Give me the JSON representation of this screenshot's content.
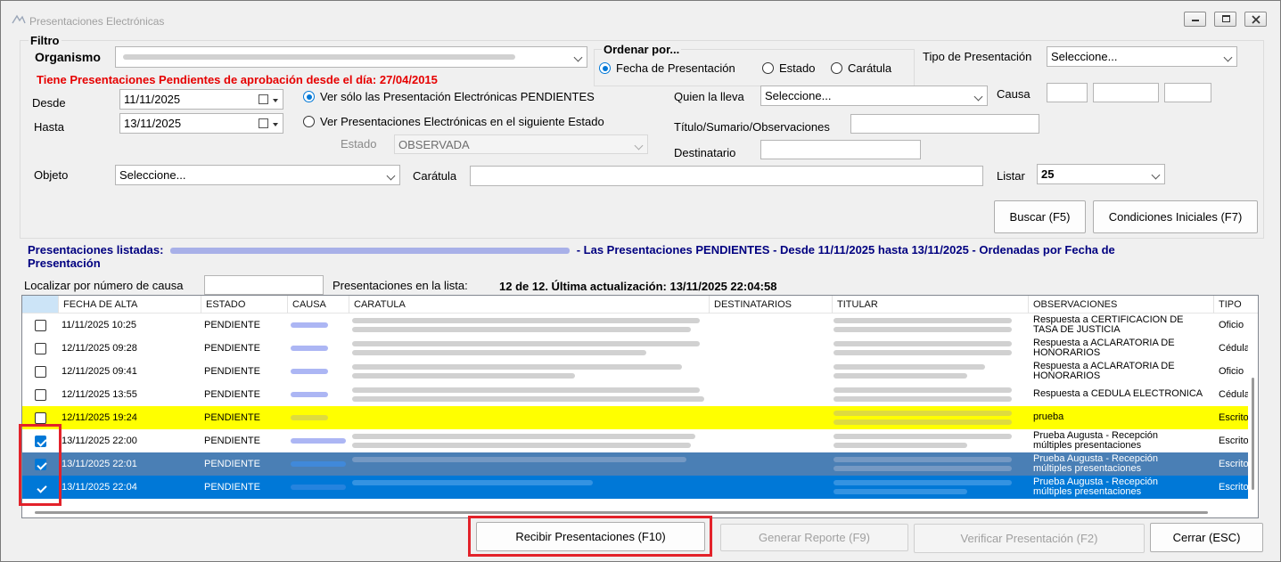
{
  "window": {
    "title": "Presentaciones Electrónicas"
  },
  "filtro": {
    "legend": "Filtro",
    "organismo_label": "Organismo",
    "alert": "Tiene Presentaciones Pendientes de aprobación desde el día: 27/04/2015",
    "desde_label": "Desde",
    "desde_value": "11/11/2025",
    "hasta_label": "Hasta",
    "hasta_value": "13/11/2025",
    "radio_pendientes": "Ver sólo las Presentación Electrónicas PENDIENTES",
    "radio_estado": "Ver Presentaciones Electrónicas en el siguiente Estado",
    "estado_label": "Estado",
    "estado_value": "OBSERVADA",
    "ordenar_label": "Ordenar por...",
    "ordenar_fecha": "Fecha de Presentación",
    "ordenar_estado": "Estado",
    "ordenar_caratula": "Carátula",
    "tipo_label": "Tipo de Presentación",
    "tipo_value": "Seleccione...",
    "quien_label": "Quien la lleva",
    "quien_value": "Seleccione...",
    "causa_label": "Causa",
    "titulo_label": "Título/Sumario/Observaciones",
    "destinatario_label": "Destinatario",
    "objeto_label": "Objeto",
    "objeto_value": "Seleccione...",
    "caratula_label": "Carátula",
    "listar_label": "Listar",
    "listar_value": "25",
    "buscar_button": "Buscar (F5)",
    "condiciones_button": "Condiciones Iniciales (F7)"
  },
  "summary": {
    "prefix": "Presentaciones listadas:",
    "suffix": "- Las Presentaciones PENDIENTES - Desde 11/11/2025 hasta 13/11/2025 - Ordenadas por Fecha de",
    "line2": "Presentación"
  },
  "localizar_label": "Localizar por número de causa",
  "lista_label": "Presentaciones en la lista:",
  "lista_value": "12 de 12. Última actualización: 13/11/2025 22:04:58",
  "grid": {
    "headers": [
      "FECHA DE ALTA",
      "ESTADO",
      "CAUSA",
      "CARATULA",
      "DESTINATARIOS",
      "TITULAR",
      "OBSERVACIONES",
      "TIPO"
    ],
    "rows": [
      {
        "fecha": "11/11/2025 10:25",
        "estado": "PENDIENTE",
        "obs1": "Respuesta a CERTIFICACION DE",
        "obs2": "TASA DE JUSTICIA",
        "tipo": "Oficio",
        "checked": false,
        "style": "normal"
      },
      {
        "fecha": "12/11/2025 09:28",
        "estado": "PENDIENTE",
        "obs1": "Respuesta a ACLARATORIA DE",
        "obs2": "HONORARIOS",
        "tipo": "Cédula",
        "checked": false,
        "style": "normal"
      },
      {
        "fecha": "12/11/2025 09:41",
        "estado": "PENDIENTE",
        "obs1": "Respuesta a ACLARATORIA DE",
        "obs2": "HONORARIOS",
        "tipo": "Oficio",
        "checked": false,
        "style": "normal"
      },
      {
        "fecha": "12/11/2025 13:55",
        "estado": "PENDIENTE",
        "obs1": "Respuesta a CEDULA ELECTRONICA",
        "obs2": "",
        "tipo": "Cédula",
        "checked": false,
        "style": "normal"
      },
      {
        "fecha": "12/11/2025 19:24",
        "estado": "PENDIENTE",
        "obs1": "prueba",
        "obs2": "",
        "tipo": "Escrito",
        "checked": false,
        "style": "yellow"
      },
      {
        "fecha": "13/11/2025 22:00",
        "estado": "PENDIENTE",
        "obs1": "Prueba Augusta -  Recepción",
        "obs2": "múltiples presentaciones",
        "tipo": "Escrito",
        "checked": true,
        "style": "normal"
      },
      {
        "fecha": "13/11/2025 22:01",
        "estado": "PENDIENTE",
        "obs1": "Prueba Augusta -  Recepción",
        "obs2": "múltiples presentaciones",
        "tipo": "Escrito",
        "checked": true,
        "style": "steel"
      },
      {
        "fecha": "13/11/2025 22:04",
        "estado": "PENDIENTE",
        "obs1": "Prueba Augusta -  Recepción",
        "obs2": "múltiples presentaciones",
        "tipo": "Escrito",
        "checked": true,
        "style": "blue"
      }
    ]
  },
  "buttons": {
    "recibir": "Recibir  Presentaciones (F10)",
    "reporte": "Generar Reporte (F9)",
    "verificar": "Verificar  Presentación (F2)",
    "cerrar": "Cerrar (ESC)"
  },
  "colors": {
    "alert": "#e60000",
    "summary": "#000080",
    "yellow": "#ffff00",
    "steel": "#4a7fb5",
    "blue": "#0078d7",
    "highlight": "#e3222a"
  }
}
